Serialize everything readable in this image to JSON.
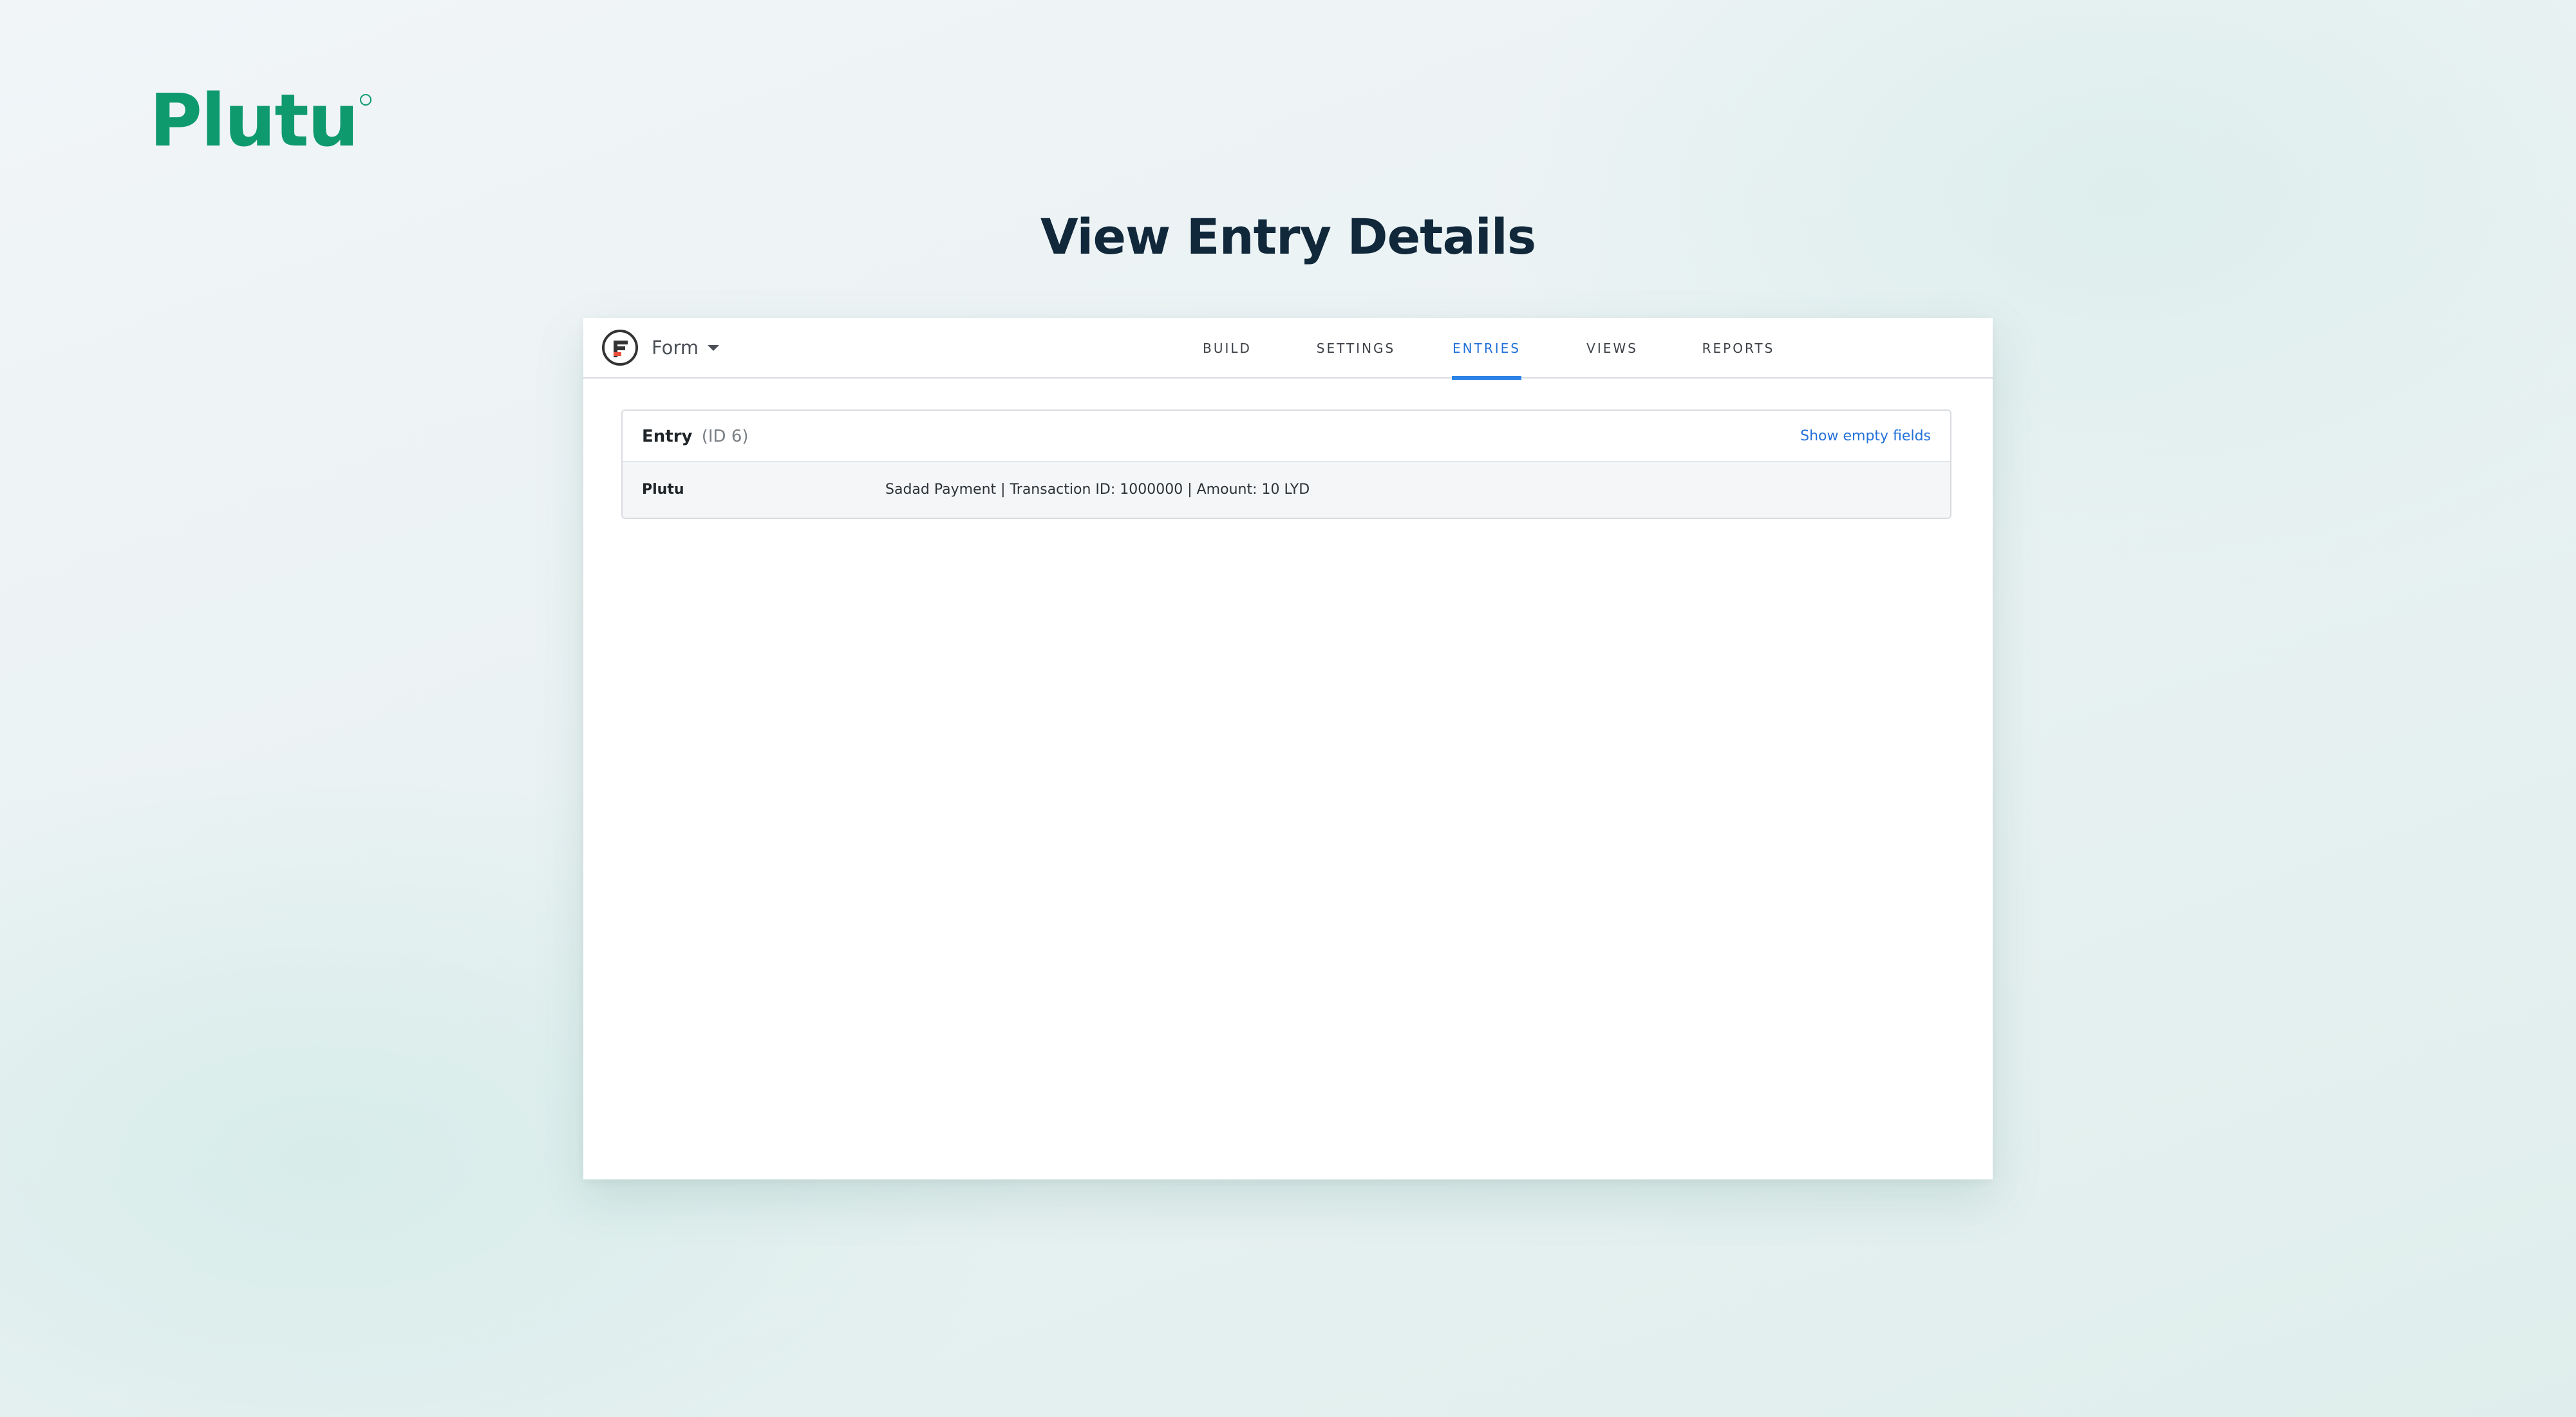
{
  "brand": {
    "name": "Plutu"
  },
  "page": {
    "heading": "View Entry Details"
  },
  "app": {
    "form_title": "Form",
    "tabs": [
      {
        "label": "BUILD",
        "active": false
      },
      {
        "label": "SETTINGS",
        "active": false
      },
      {
        "label": "ENTRIES",
        "active": true
      },
      {
        "label": "VIEWS",
        "active": false
      },
      {
        "label": "REPORTS",
        "active": false
      }
    ],
    "entry": {
      "title": "Entry",
      "id_text": "(ID 6)",
      "show_empty_label": "Show empty fields",
      "fields": [
        {
          "label": "Plutu",
          "value": "Sadad Payment | Transaction ID: 1000000 | Amount: 10 LYD"
        }
      ]
    }
  },
  "colors": {
    "brand_green": "#0f9a6e",
    "heading": "#11283b",
    "accent_blue": "#2271d9",
    "tab_underline": "#2b83e6"
  }
}
